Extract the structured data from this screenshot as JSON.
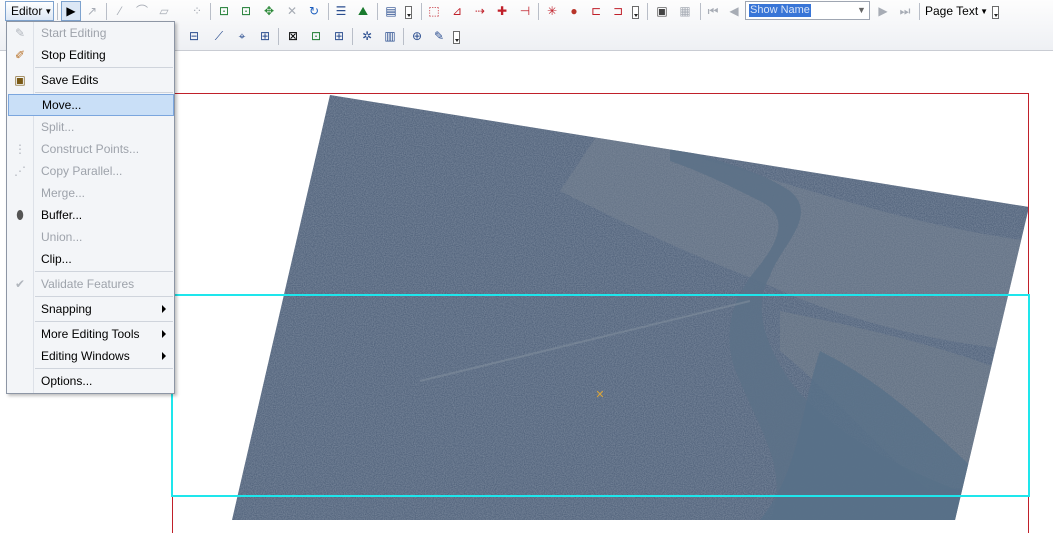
{
  "toolbar": {
    "editor_label": "Editor",
    "name_combo_value": "Show Name",
    "page_text_label": "Page Text"
  },
  "icons": {
    "select": "▶",
    "edit_vertices": "↗",
    "straight_segment": "⁄",
    "end_point_arc": "⌒",
    "trace": "▱",
    "midpoint": "⁘",
    "topology_edit": "⊡",
    "topology_edit2": "⊡",
    "move_tool": "✥",
    "split_tool": "✕",
    "rotate_tool": "↻",
    "attributes": "☰",
    "sketch_properties": "⛰",
    "create_features": "▤",
    "error_inspector": "⬚",
    "network_a": "⊿",
    "network_b": "⇢",
    "network_c": "✚",
    "network_d": "⊣",
    "geometric_network": "✳",
    "globe": "●",
    "flow_a": "⊏",
    "flow_b": "⊐",
    "layout_a": "▣",
    "layout_b": "▦",
    "first": "⏮",
    "prev": "◀",
    "next": "▶",
    "last": "⏭",
    "row2": [
      "⊟",
      "⟋",
      "⌖",
      "⊞",
      "⊠",
      "⊡",
      "⊞",
      "✲",
      "▥",
      "⊕",
      "✎",
      "⊗",
      "⊘"
    ]
  },
  "menu": {
    "items": [
      {
        "label": "Start Editing",
        "icon": "✎",
        "disabled": true
      },
      {
        "label": "Stop Editing",
        "icon": "✐",
        "disabled": false
      },
      {
        "label": "Save Edits",
        "icon": "▣",
        "disabled": false
      },
      {
        "label": "Move...",
        "icon": "",
        "disabled": false,
        "highlighted": true
      },
      {
        "label": "Split...",
        "icon": "",
        "disabled": true
      },
      {
        "label": "Construct Points...",
        "icon": "⋮",
        "disabled": true
      },
      {
        "label": "Copy Parallel...",
        "icon": "⋰",
        "disabled": true
      },
      {
        "label": "Merge...",
        "icon": "",
        "disabled": true
      },
      {
        "label": "Buffer...",
        "icon": "⬮",
        "disabled": false
      },
      {
        "label": "Union...",
        "icon": "",
        "disabled": true
      },
      {
        "label": "Clip...",
        "icon": "",
        "disabled": false
      },
      {
        "label": "Validate Features",
        "icon": "✔",
        "disabled": true
      },
      {
        "label": "Snapping",
        "icon": "",
        "disabled": false,
        "submenu": true
      },
      {
        "label": "More Editing Tools",
        "icon": "",
        "disabled": false,
        "submenu": true
      },
      {
        "label": "Editing Windows",
        "icon": "",
        "disabled": false,
        "submenu": true
      },
      {
        "label": "Options...",
        "icon": "",
        "disabled": false
      }
    ]
  },
  "colors": {
    "frame": "#c0202a",
    "selection": "#1ee6ec",
    "menu_highlight": "#c9dff7"
  }
}
